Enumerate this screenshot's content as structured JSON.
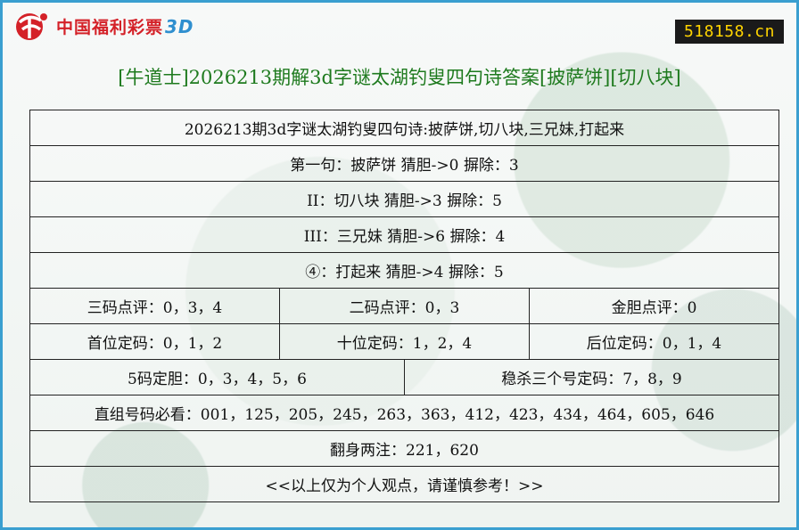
{
  "header": {
    "logo_text": "中国福利彩票",
    "logo_suffix": "3D",
    "site_badge": "518158.cn",
    "title": "[牛道士]2026213期解3d字谜太湖钓叟四句诗答案[披萨饼][切八块]"
  },
  "rows": {
    "poem": "2026213期3d字谜太湖钓叟四句诗:披萨饼,切八块,三兄妹,打起来",
    "line1": "第一句：披萨饼 猜胆->0 摒除：3",
    "line2": "II：切八块 猜胆->3 摒除：5",
    "line3": "III：三兄妹 猜胆->6 摒除：4",
    "line4": "④：打起来 猜胆->4 摒除：5",
    "three_code": "三码点评：0，3，4",
    "two_code": "二码点评：0，3",
    "gold_dan": "金胆点评：0",
    "hundreds": "首位定码：0，1，2",
    "tens": "十位定码：1，2，4",
    "units": "后位定码：0，1，4",
    "five_dan": "5码定胆：0，3，4，5，6",
    "kill_three": "稳杀三个号定码：7，8，9",
    "direct": "直组号码必看：001，125，205，245，263，363，412，423，434，464，605，646",
    "flip": "翻身两注：221，620",
    "disclaimer": "<<以上仅为个人观点，请谨慎参考！>>"
  },
  "colors": {
    "border": "#3a9fd0",
    "title": "#1e7a1e",
    "logo_red": "#d42128",
    "badge_bg": "#1a1a1a",
    "badge_text": "#ffd400"
  }
}
